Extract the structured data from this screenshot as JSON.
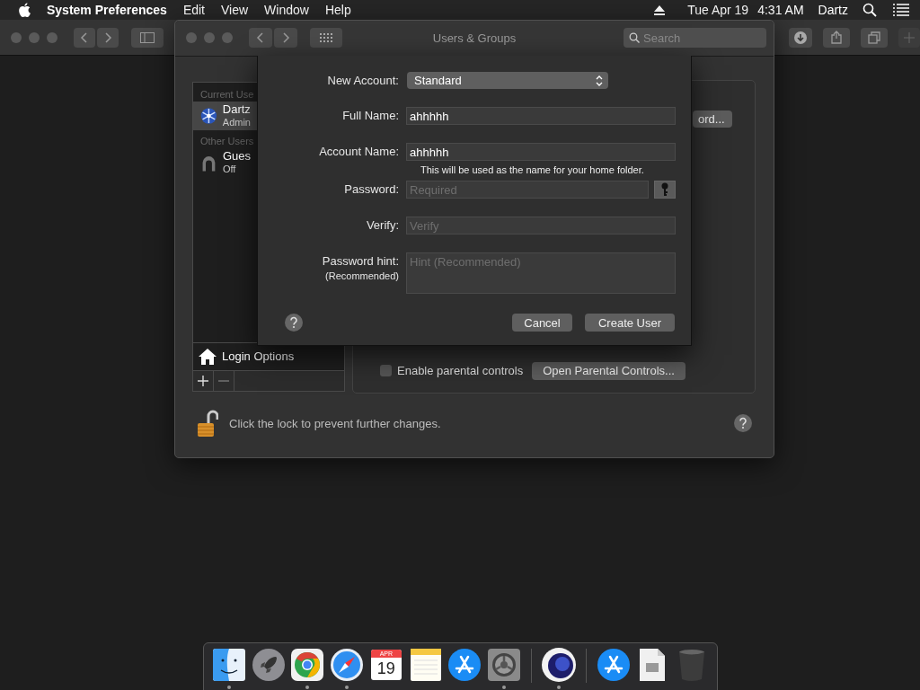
{
  "menubar": {
    "app": "System Preferences",
    "menus": [
      "Edit",
      "View",
      "Window",
      "Help"
    ],
    "date": "Tue Apr 19",
    "time": "4:31 AM",
    "user": "Dartz"
  },
  "window": {
    "title": "Users & Groups",
    "search": {
      "placeholder": "Search"
    }
  },
  "users": {
    "sections": [
      {
        "header": "Current Use",
        "items": [
          {
            "name": "Dartz",
            "role": "Admin",
            "kind": "admin",
            "selected": true
          }
        ]
      },
      {
        "header": "Other Users",
        "items": [
          {
            "name": "Gues",
            "role": "Off",
            "kind": "guest",
            "selected": false
          }
        ]
      }
    ],
    "login_options": "Login Options"
  },
  "account_panel": {
    "password_button": "ord...",
    "parental_controls": {
      "label": "Enable parental controls",
      "checked": false
    },
    "open_button": "Open Parental Controls..."
  },
  "lock": {
    "text": "Click the lock to prevent further changes.",
    "locked": false
  },
  "sheet": {
    "new_account": {
      "label": "New Account:",
      "value": "Standard"
    },
    "fields": [
      {
        "kind": "text",
        "label": "Full Name:",
        "value": "ahhhhh"
      },
      {
        "kind": "text",
        "label": "Account Name:",
        "value": "ahhhhh",
        "note": "This will be used as the name for your home folder."
      },
      {
        "kind": "password",
        "label": "Password:",
        "placeholder": "Required"
      },
      {
        "kind": "text",
        "label": "Verify:",
        "placeholder": "Verify"
      },
      {
        "kind": "textarea",
        "label": "Password hint:",
        "sublabel": "(Recommended)",
        "placeholder": "Hint (Recommended)"
      }
    ],
    "buttons": [
      "Cancel",
      "Create User"
    ]
  },
  "dock": {
    "items": [
      {
        "kind": "finder",
        "running": true
      },
      {
        "kind": "launchpad",
        "running": false
      },
      {
        "kind": "chrome",
        "running": true
      },
      {
        "kind": "safari",
        "running": true
      },
      {
        "kind": "calendar",
        "month": "APR",
        "day": "19",
        "running": false
      },
      {
        "kind": "notes",
        "running": false
      },
      {
        "kind": "appstore",
        "running": false
      },
      {
        "kind": "settings",
        "running": true
      },
      {
        "kind": "separator"
      },
      {
        "kind": "sphere",
        "running": true
      },
      {
        "kind": "separator"
      },
      {
        "kind": "appstore",
        "running": false
      },
      {
        "kind": "document",
        "running": false
      },
      {
        "kind": "trash",
        "running": false
      }
    ]
  }
}
